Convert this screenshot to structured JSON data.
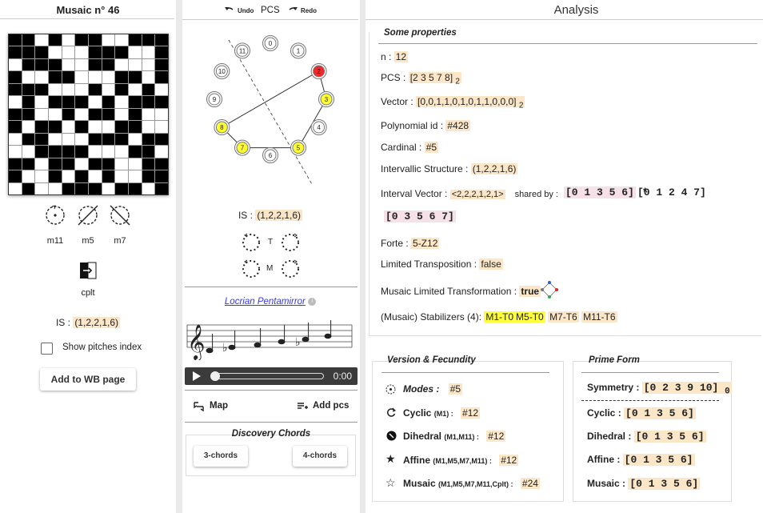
{
  "left": {
    "title": "Musaic n° 46",
    "grid": [
      "110101100111",
      "111000111001",
      "011100110001",
      "100110001101",
      "111000101010",
      "010111010111",
      "110010110100",
      "101101001100",
      "011000111011",
      "001111000110",
      "110110110011",
      "100101010011",
      "010011101101"
    ],
    "ops": [
      "m11",
      "m5",
      "m7"
    ],
    "cplt": "cplt",
    "is_label": "IS : ",
    "is_value": "(1,2,2,1,6)",
    "show_index": "Show pitches index",
    "add_wb": "Add to WB page"
  },
  "mid": {
    "undo": "Undo",
    "pcs": "PCS",
    "redo": "Redo",
    "clock": [
      {
        "n": "0",
        "state": "off"
      },
      {
        "n": "1",
        "state": "off"
      },
      {
        "n": "2",
        "state": "red"
      },
      {
        "n": "3",
        "state": "yellow"
      },
      {
        "n": "4",
        "state": "off"
      },
      {
        "n": "5",
        "state": "yellow"
      },
      {
        "n": "6",
        "state": "off"
      },
      {
        "n": "7",
        "state": "yellow"
      },
      {
        "n": "8",
        "state": "yellow"
      },
      {
        "n": "9",
        "state": "off"
      },
      {
        "n": "10",
        "state": "off"
      },
      {
        "n": "11",
        "state": "off"
      }
    ],
    "is_label": "IS : ",
    "is_value": "(1,2,2,1,6)",
    "t": "T",
    "m": "M",
    "scale_name": "Locrian Pentamirror",
    "time": "0:00",
    "map": "Map",
    "add_pcs": "Add pcs",
    "discovery": "Discovery Chords",
    "chord3": "3-chords",
    "chord4": "4-chords"
  },
  "right": {
    "title": "Analysis",
    "props_title": "Some properties",
    "n_label": "n : ",
    "n_value": "12",
    "pcs_label": "PCS : ",
    "pcs_value": "[2 3 5 7 8]",
    "pcs_sub": "2",
    "vector_label": "Vector : ",
    "vector_value": "[0,0,1,1,0,1,0,1,1,0,0,0]",
    "vector_sub": "2",
    "poly_label": "Polynomial id : ",
    "poly_value": "#428",
    "card_label": "Cardinal : ",
    "card_value": "#5",
    "is_label": "Intervallic Structure : ",
    "is_value": "(1,2,2,1,6)",
    "iv_label": "Interval Vector : ",
    "iv_value": "<2,2,2,1,2,1>",
    "shared": "shared by :",
    "shared_items": [
      "[0 1 3 5 6]",
      "[0 1 2 4 7]",
      "[0 3 5 6 7]"
    ],
    "star": "*",
    "forte_label": "Forte : ",
    "forte_value": "5-Z12",
    "lt_label": "Limited Transposition : ",
    "lt_value": "false",
    "mlt_label": "Musaic Limited Transformation : ",
    "mlt_value": "true",
    "stab_label": "(Musaic) Stabilizers (4):",
    "stabs_y": [
      "M1-T0",
      "M5-T0"
    ],
    "stabs": [
      "M7-T6",
      "M11-T6"
    ],
    "vf_title": "Version & Fecundity",
    "modes_label": "Modes :",
    "modes_value": "#5",
    "cyclic_label": "Cyclic",
    "cyclic_sub": "(M1) :",
    "cyclic_value": "#12",
    "dihedral_label": "Dihedral",
    "dihedral_sub": "(M1,M11) :",
    "dihedral_value": "#12",
    "affine_label": "Affine",
    "affine_sub": "(M1,M5,M7,M11) :",
    "affine_value": "#12",
    "musaic_label": "Musaic",
    "musaic_sub": "(M1,M5,M7,M11,Cplt) :",
    "musaic_value": "#24",
    "pf_title": "Prime Form",
    "sym_label": "Symmetry : ",
    "sym_value": "[0 2 3 9 10]",
    "sym_sub": "0",
    "pf_cyclic_label": "Cyclic : ",
    "pf_cyclic": "[0 1 3 5 6]",
    "pf_dihedral_label": "Dihedral : ",
    "pf_dihedral": "[0 1 3 5 6]",
    "pf_affine_label": "Affine : ",
    "pf_affine": "[0 1 3 5 6]",
    "pf_musaic_label": "Musaic : ",
    "pf_musaic": "[0 1 3 5 6]"
  }
}
